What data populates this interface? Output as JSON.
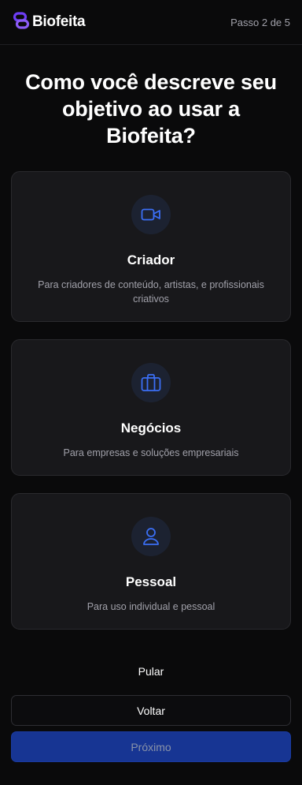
{
  "header": {
    "brand_name": "Biofeita",
    "step_text": "Passo 2 de 5",
    "brand_color": "#6d3df5"
  },
  "title": "Como você descreve seu objetivo ao usar a Biofeita?",
  "options": [
    {
      "icon": "video-camera-icon",
      "title": "Criador",
      "description": "Para criadores de conteúdo, artistas, e profissionais criativos"
    },
    {
      "icon": "briefcase-icon",
      "title": "Negócios",
      "description": "Para empresas e soluções empresariais"
    },
    {
      "icon": "user-icon",
      "title": "Pessoal",
      "description": "Para uso individual e pessoal"
    }
  ],
  "actions": {
    "skip_label": "Pular",
    "back_label": "Voltar",
    "next_label": "Próximo"
  },
  "colors": {
    "accent_icon": "#3b6ff5",
    "next_button_bg": "#173593"
  }
}
